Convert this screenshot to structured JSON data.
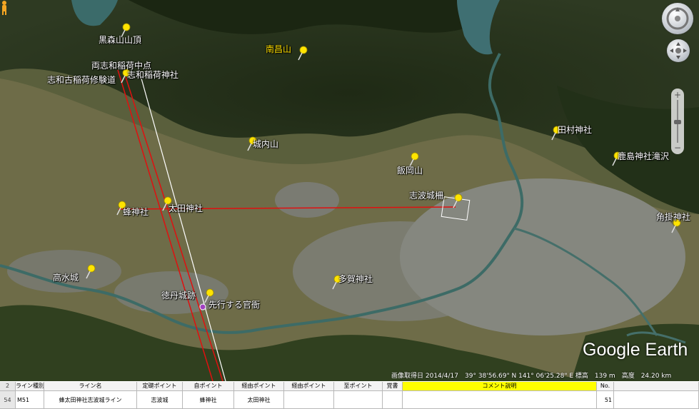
{
  "map": {
    "placemarks": [
      {
        "label": "黒森山山頂",
        "yellow": false
      },
      {
        "label": "両志和稲荷中点",
        "yellow": false
      },
      {
        "label": "志和稲荷神社",
        "yellow": false
      },
      {
        "label": "志和古稲荷修験道",
        "yellow": false
      },
      {
        "label": "南昌山",
        "yellow": true
      },
      {
        "label": "城内山",
        "yellow": false
      },
      {
        "label": "飯岡山",
        "yellow": false
      },
      {
        "label": "田村神社",
        "yellow": false
      },
      {
        "label": "鹿島神社滝沢",
        "yellow": false
      },
      {
        "label": "志波城柵",
        "yellow": false
      },
      {
        "label": "角掛神社",
        "yellow": false
      },
      {
        "label": "蜂神社",
        "yellow": false
      },
      {
        "label": "太田神社",
        "yellow": false
      },
      {
        "label": "高水城",
        "yellow": false
      },
      {
        "label": "多賀神社",
        "yellow": false
      },
      {
        "label": "徳丹城跡",
        "yellow": false
      },
      {
        "label": "先行する官衙",
        "yellow": false
      }
    ],
    "status_bar": "画像取得日 2014/4/17　39° 38'56.69\" N 141° 06'25.28\" E 標高　139 m　高度　24.20 km",
    "logo": "Google Earth",
    "colors": {
      "line_red": "#e01010",
      "line_white": "#ffffff",
      "pin_yellow": "#ffe400"
    }
  },
  "controls": {
    "compass": "compass-icon",
    "look": "look-joystick-icon",
    "pegman": "pegman-icon",
    "zoom_plus": "+",
    "zoom_minus": "−"
  },
  "sheet": {
    "row_numbers": [
      "2",
      "54"
    ],
    "headers": [
      "ライン種別",
      "ライン名",
      "定礎ポイント",
      "自ポイント",
      "経由ポイント",
      "経由ポイント",
      "至ポイント",
      "覚書",
      "コメント説明",
      "No."
    ],
    "row": [
      "M51",
      "蜂太田神社志波城ライン",
      "志波城",
      "蜂神社",
      "太田神社",
      "",
      "",
      "",
      "",
      "51"
    ]
  }
}
